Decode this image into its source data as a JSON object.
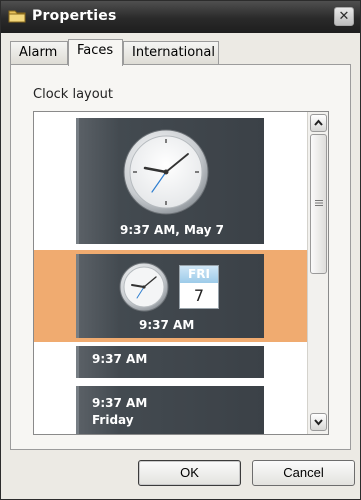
{
  "window": {
    "title": "Properties",
    "close_glyph": "✕",
    "title_icon": "folder-icon"
  },
  "tabs": [
    {
      "label": "Alarm",
      "active": false
    },
    {
      "label": "Faces",
      "active": true
    },
    {
      "label": "International",
      "active": false
    }
  ],
  "faces_panel": {
    "section_label": "Clock layout",
    "layouts": [
      {
        "time_line": "9:37 AM, May 7",
        "kind": "analog-large",
        "selected": false
      },
      {
        "time_line": "9:37 AM",
        "kind": "analog-small-with-calendar",
        "selected": true,
        "calendar_day": "FRI",
        "calendar_date": "7"
      },
      {
        "time_line": "9:37 AM",
        "kind": "digital",
        "selected": false
      },
      {
        "time_line": "9:37 AM",
        "second_line": "Friday",
        "kind": "digital-with-day",
        "selected": false
      }
    ]
  },
  "buttons": {
    "ok": "OK",
    "cancel": "Cancel"
  },
  "colors": {
    "selection": "#f0ab70",
    "face_background": "#3b4147",
    "titlebar": "#2a2a2a"
  }
}
